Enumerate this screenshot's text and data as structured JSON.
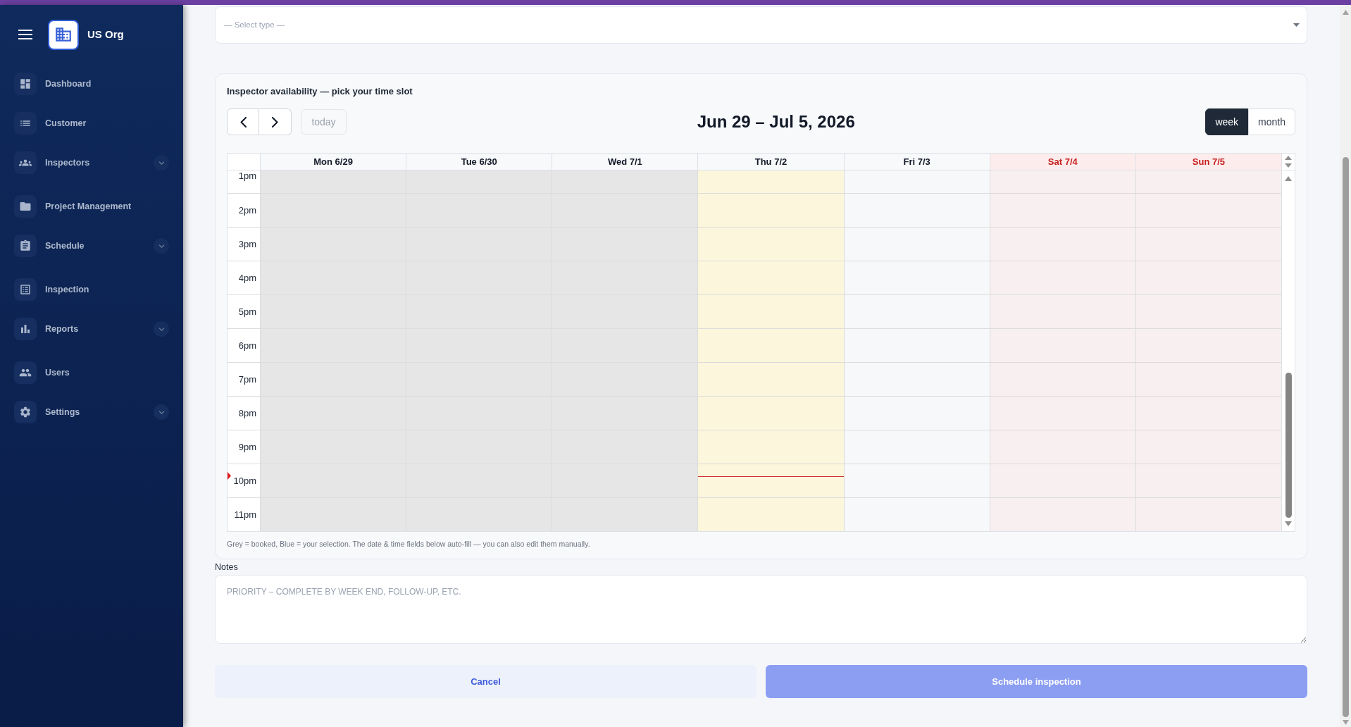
{
  "sidebar": {
    "org_name": "US Org",
    "items": [
      {
        "label": "Dashboard",
        "selected": false,
        "has_submenu": false
      },
      {
        "label": "Customer",
        "selected": false,
        "has_submenu": false
      },
      {
        "label": "Inspectors",
        "selected": false,
        "has_submenu": true
      },
      {
        "label": "Project Management",
        "selected": false,
        "has_submenu": false
      },
      {
        "label": "Schedule",
        "selected": false,
        "has_submenu": true
      },
      {
        "label": "Inspection",
        "selected": false,
        "has_submenu": false
      },
      {
        "label": "Reports",
        "selected": false,
        "has_submenu": true
      },
      {
        "label": "Users",
        "selected": false,
        "has_submenu": false
      },
      {
        "label": "Settings",
        "selected": false,
        "has_submenu": true
      }
    ]
  },
  "type_select": {
    "placeholder": "— Select type —"
  },
  "availability": {
    "title": "Inspector availability — pick your time slot",
    "today_button": {
      "label": "today",
      "disabled": true
    },
    "range_title": "Jun 29 – Jul 5, 2026",
    "views": [
      {
        "label": "week",
        "selected": true
      },
      {
        "label": "month",
        "selected": false
      }
    ],
    "days": [
      {
        "label": "Mon 6/29",
        "kind": "booked"
      },
      {
        "label": "Tue 6/30",
        "kind": "booked"
      },
      {
        "label": "Wed 7/1",
        "kind": "booked"
      },
      {
        "label": "Thu 7/2",
        "kind": "today"
      },
      {
        "label": "Fri 7/3",
        "kind": "open"
      },
      {
        "label": "Sat 7/4",
        "kind": "weekend"
      },
      {
        "label": "Sun 7/5",
        "kind": "weekend"
      }
    ],
    "hours": [
      {
        "label": "1pm",
        "current": false
      },
      {
        "label": "2pm",
        "current": false
      },
      {
        "label": "3pm",
        "current": false
      },
      {
        "label": "4pm",
        "current": false
      },
      {
        "label": "5pm",
        "current": false
      },
      {
        "label": "6pm",
        "current": false
      },
      {
        "label": "7pm",
        "current": false
      },
      {
        "label": "8pm",
        "current": false
      },
      {
        "label": "9pm",
        "current": false
      },
      {
        "label": "10pm",
        "current": true
      },
      {
        "label": "11pm",
        "current": false
      }
    ],
    "legend": "Grey = booked, Blue = your selection. The date & time fields below auto-fill — you can also edit them manually."
  },
  "notes": {
    "label": "Notes",
    "placeholder": "PRIORITY – COMPLETE BY WEEK END, FOLLOW-UP, ETC."
  },
  "actions": [
    {
      "label": "Cancel",
      "kind": "secondary",
      "disabled": false
    },
    {
      "label": "Schedule inspection",
      "kind": "primary",
      "disabled": true
    }
  ]
}
